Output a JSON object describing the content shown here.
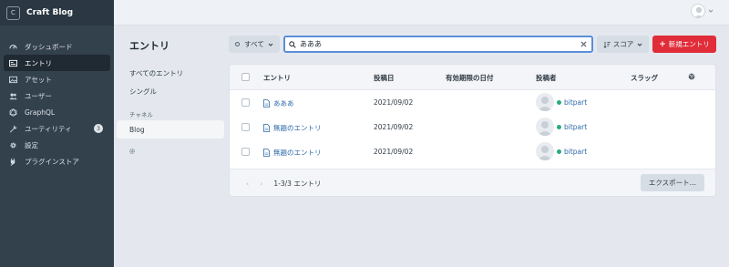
{
  "app": {
    "title": "Craft Blog",
    "logo_letter": "C"
  },
  "sidebar": {
    "items": [
      {
        "label": "ダッシュボード",
        "icon": "gauge-icon"
      },
      {
        "label": "エントリ",
        "icon": "newspaper-icon",
        "active": true
      },
      {
        "label": "アセット",
        "icon": "image-icon"
      },
      {
        "label": "ユーザー",
        "icon": "users-icon"
      },
      {
        "label": "GraphQL",
        "icon": "graphql-icon"
      },
      {
        "label": "ユーティリティ",
        "icon": "wrench-icon",
        "badge": "3"
      },
      {
        "label": "設定",
        "icon": "gear-icon"
      },
      {
        "label": "プラグインストア",
        "icon": "plug-icon"
      }
    ]
  },
  "page": {
    "title": "エントリ"
  },
  "sources": {
    "all": "すべてのエントリ",
    "singles": "シングル",
    "channels_heading": "チャネル",
    "blog": "Blog"
  },
  "toolbar": {
    "status_label": "すべて",
    "search_value": "あああ",
    "sort_label": "スコア",
    "new_entry_label": "新規エントリ"
  },
  "table": {
    "columns": [
      "エントリ",
      "投稿日",
      "有効期限の日付",
      "投稿者",
      "スラッグ"
    ],
    "rows": [
      {
        "title": "あああ",
        "post_date": "2021/09/02",
        "expiry": "",
        "author": "bitpart",
        "slug": ""
      },
      {
        "title": "無題のエントリ",
        "post_date": "2021/09/02",
        "expiry": "",
        "author": "bitpart",
        "slug": ""
      },
      {
        "title": "無題のエントリ",
        "post_date": "2021/09/02",
        "expiry": "",
        "author": "bitpart",
        "slug": ""
      }
    ]
  },
  "footer": {
    "count_label": "1-3/3 エントリ",
    "export_label": "エクスポート…"
  },
  "colors": {
    "accent": "#e12d39",
    "sidebar": "#33414d",
    "link": "#2d6aa8",
    "online": "#27ab83"
  }
}
